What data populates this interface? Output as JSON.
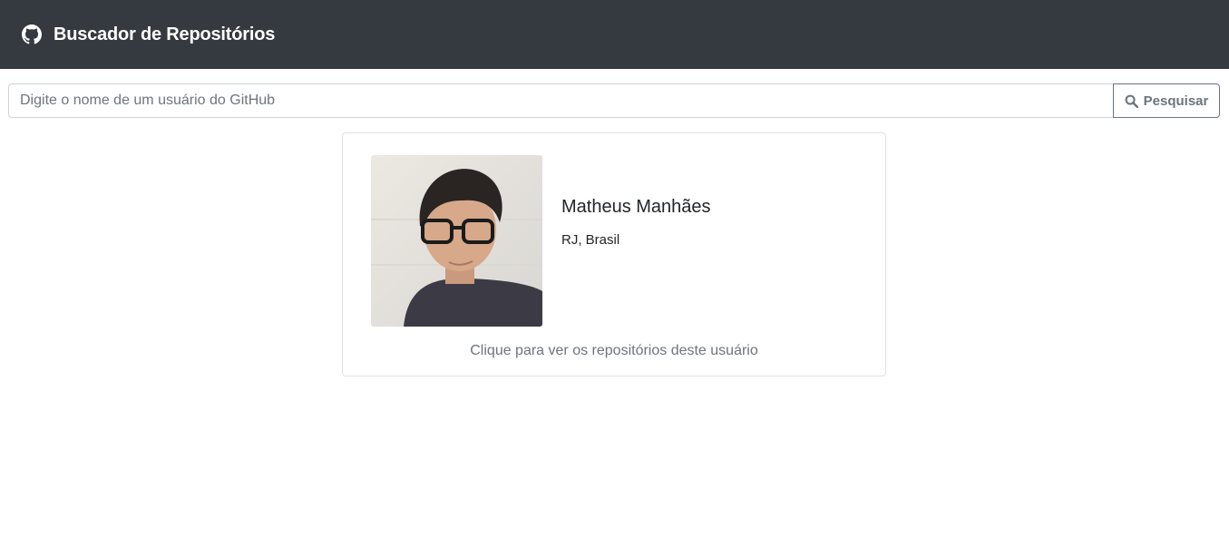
{
  "header": {
    "title": "Buscador de Repositórios",
    "icon": "github-icon"
  },
  "search": {
    "placeholder": "Digite o nome de um usuário do GitHub",
    "value": "",
    "button_label": "Pesquisar",
    "button_icon": "search-icon"
  },
  "user_card": {
    "name": "Matheus Manhães",
    "location": "RJ, Brasil",
    "hint": "Clique para ver os repositórios deste usuário"
  },
  "colors": {
    "navbar": "#343a40",
    "secondary": "#6c757d",
    "border": "#dee2e6"
  }
}
